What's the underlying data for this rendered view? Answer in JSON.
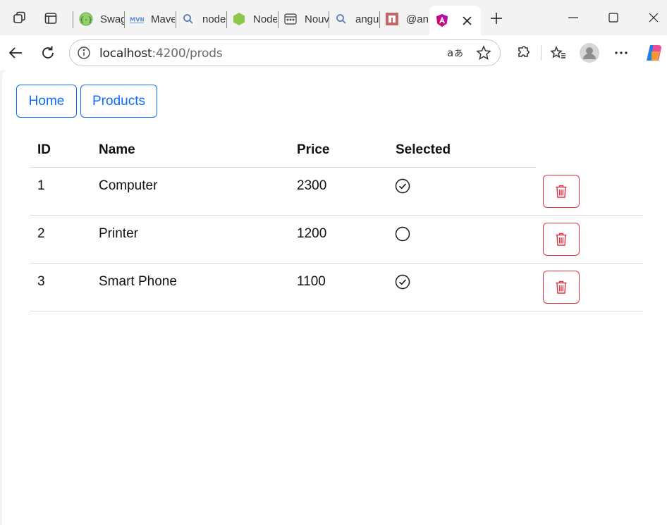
{
  "browser": {
    "tabs": [
      {
        "title": "Swagger",
        "favicon": "swagger-icon"
      },
      {
        "title": "Maven",
        "favicon": "maven-icon"
      },
      {
        "title": "node",
        "favicon": "search-icon"
      },
      {
        "title": "Node",
        "favicon": "nodejs-icon"
      },
      {
        "title": "Nouveau",
        "favicon": "window-icon"
      },
      {
        "title": "angular",
        "favicon": "search-icon"
      },
      {
        "title": "@angular",
        "favicon": "npm-icon"
      },
      {
        "title": "",
        "favicon": "angular-icon",
        "active": true
      }
    ],
    "url_host": "localhost",
    "url_path": ":4200/prods"
  },
  "nav": {
    "home_label": "Home",
    "products_label": "Products"
  },
  "table": {
    "headers": [
      "ID",
      "Name",
      "Price",
      "Selected"
    ],
    "rows": [
      {
        "id": "1",
        "name": "Computer",
        "price": "2300",
        "selected": true
      },
      {
        "id": "2",
        "name": "Printer",
        "price": "1200",
        "selected": false
      },
      {
        "id": "3",
        "name": "Smart Phone",
        "price": "1100",
        "selected": true
      }
    ]
  },
  "colors": {
    "primary": "#0d6efd",
    "danger": "#dc3545",
    "angular": "#dd0031"
  }
}
